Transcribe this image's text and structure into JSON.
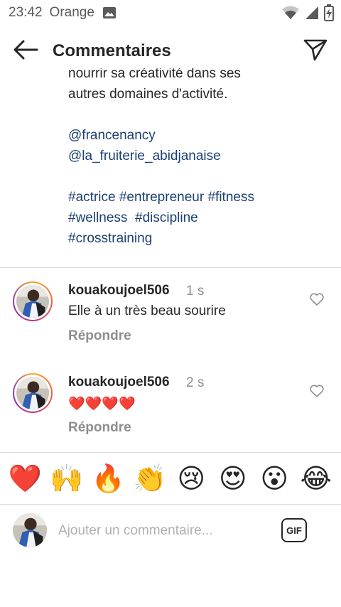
{
  "status_bar": {
    "time": "23:42",
    "carrier": "Orange",
    "icons": [
      "gallery-icon",
      "wifi-icon",
      "signal-icon",
      "battery-charging-icon"
    ]
  },
  "header": {
    "title": "Commentaires",
    "back_icon": "arrow-left-icon",
    "send_icon": "paper-plane-icon"
  },
  "caption": {
    "partial_line": "nourrir sa créativité dans ses",
    "text_line": "autres domaines d'activité.",
    "mentions": [
      "@francenancy",
      "@la_fruiterie_abidjanaise"
    ],
    "hashtag_lines": [
      [
        "#actrice",
        "#entrepreneur",
        "#fitness"
      ],
      [
        "#wellness",
        "#discipline"
      ],
      [
        "#crosstraining"
      ]
    ]
  },
  "comments": [
    {
      "username": "kouakoujoel506",
      "time": "1 s",
      "text": "Elle à un très beau sourire",
      "reply_label": "Répondre"
    },
    {
      "username": "kouakoujoel506",
      "time": "2 s",
      "text": "❤️❤️❤️❤️",
      "reply_label": "Répondre"
    }
  ],
  "emoji_bar": {
    "emojis": [
      "❤️",
      "🙌",
      "🔥",
      "👏",
      "😢",
      "😍",
      "😮",
      "😂"
    ]
  },
  "comment_input": {
    "placeholder": "Ajouter un commentaire...",
    "gif_label": "GIF"
  },
  "colors": {
    "link": "#1b3f72",
    "secondary_text": "#8e8e8e",
    "divider": "#dbdbdb",
    "ring_gradient": [
      "#f9a825",
      "#f56040",
      "#c13584",
      "#833ab4"
    ]
  }
}
